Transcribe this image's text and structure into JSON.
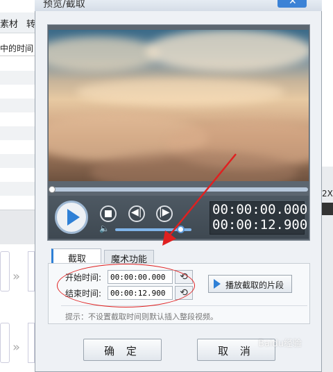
{
  "dialog": {
    "title": "预览/截取"
  },
  "background_app": {
    "tab_material": "素材",
    "tab_convert": "转",
    "column_header": "中的时间",
    "speed_label": "2X"
  },
  "player": {
    "progress": 0.0,
    "volume": 0.85,
    "time_current": "00:00:00.000",
    "time_total": "00:00:12.900"
  },
  "tabs": [
    {
      "label": "截取",
      "active": true
    },
    {
      "label": "魔术功能",
      "active": false
    }
  ],
  "capture": {
    "start_label": "开始时间:",
    "start_value": "00:00:00.000",
    "end_label": "结束时间:",
    "end_value": "00:00:12.900",
    "play_clip_label": "播放截取的片段",
    "hint": "提示：不设置截取时间则默认插入整段视频。"
  },
  "footer": {
    "ok_label": "确 定",
    "cancel_label": "取 消"
  },
  "watermark": "Baidu经验",
  "icons": [
    "close-icon",
    "play-icon",
    "stop-icon",
    "prev-frame-icon",
    "next-frame-icon",
    "volume-icon",
    "reset-time-icon",
    "chevron-down-icon"
  ],
  "colors": {
    "accent": "#2f80d6",
    "annotation": "#e02020"
  }
}
